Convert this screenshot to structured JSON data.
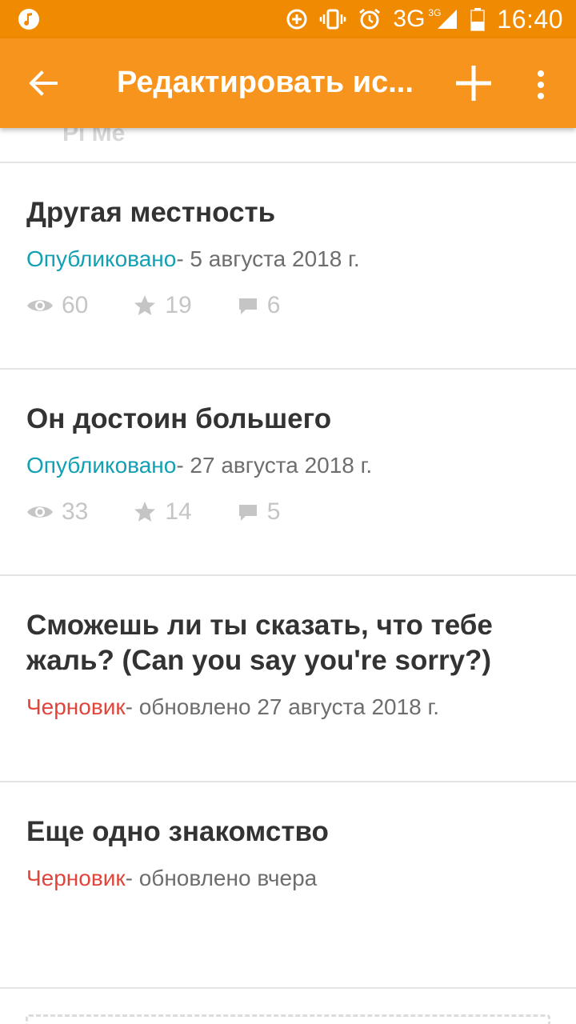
{
  "status_bar": {
    "time": "16:40",
    "network": "3G",
    "network_sup": "3G",
    "icons": [
      "music-icon",
      "data-saver-icon",
      "vibrate-icon",
      "alarm-icon",
      "signal-icon",
      "battery-icon"
    ]
  },
  "appbar": {
    "title": "Редактировать ис...",
    "icons": [
      "back-arrow-icon",
      "add-icon",
      "more-vert-icon"
    ],
    "color": "#f7941d"
  },
  "partial_item_text": "Рі Ме",
  "stories": [
    {
      "title": "Другая местность",
      "status": "Опубликовано",
      "status_type": "published",
      "meta": "- 5 августа 2018 г.",
      "views": "60",
      "stars": "19",
      "comments": "6"
    },
    {
      "title": "Он достоин большего",
      "status": "Опубликовано",
      "status_type": "published",
      "meta": "- 27 августа 2018 г.",
      "views": "33",
      "stars": "14",
      "comments": "5"
    },
    {
      "title": "Сможешь ли ты сказать, что тебе жаль? (Can you say you're sorry?)",
      "status": "Черновик",
      "status_type": "draft",
      "meta": "- обновлено 27 августа 2018 г."
    },
    {
      "title": "Еще одно знакомство",
      "status": "Черновик",
      "status_type": "draft",
      "meta": "- обновлено вчера"
    }
  ],
  "colors": {
    "published": "#11a0b4",
    "draft": "#e0453c",
    "statusbar": "#f08a00"
  }
}
